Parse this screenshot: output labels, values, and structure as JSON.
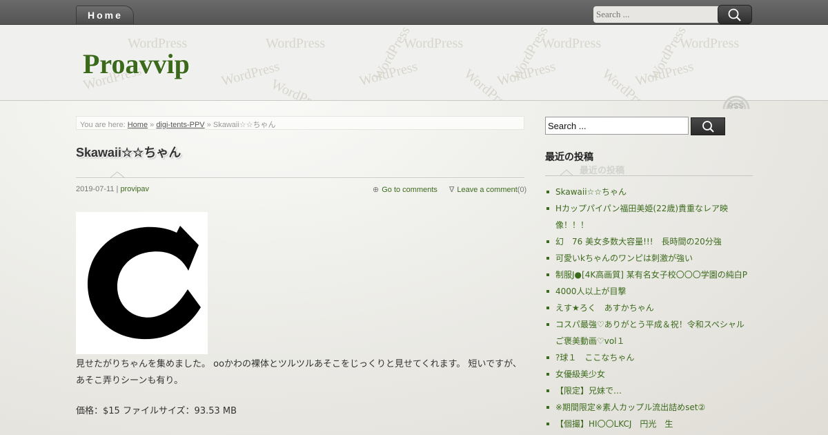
{
  "nav": {
    "home_label": "Home"
  },
  "top_search": {
    "placeholder": "Search ..."
  },
  "header": {
    "site_title": "Proavvip",
    "watermark": "WordPress",
    "rss_label": "RSS"
  },
  "breadcrumb": {
    "prefix": "You are here:",
    "home": "Home",
    "sep1": "»",
    "category": "digi-tents-PPV",
    "sep2": "»",
    "current": "Skawaii☆☆ちゃん"
  },
  "post": {
    "title": "Skawaii☆☆ちゃん",
    "date": "2019-07-11",
    "meta_sep": "|",
    "author": "provipav",
    "goto_symbol": "⊕",
    "goto_comments": "Go to comments",
    "leave_symbol": "∇",
    "leave_comment": "Leave a comment",
    "comment_count": "(0)",
    "body": "見せたがりちゃんを集めました。 ooかわの裸体とツルツルあそこをじっくりと見せてくれます。 短いですが、あそこ弄りシーンも有り。",
    "price": "価格：$15 ファイルサイズ：93.53 MB"
  },
  "sidebar": {
    "search_value": "Search ...",
    "widget_title": "最近の投稿",
    "recent_posts": [
      "Skawaii☆☆ちゃん",
      "Hカップパイパン福田美姫(22歳)貴重なレア映像！！！",
      "幻　76 美女多数大容量!!!　長時間の20分強",
      "可愛いkちゃんのワンピは刺激が強い",
      "制服J●[4K高画質] 某有名女子校〇〇〇学園の純白P",
      "4000人以上が目撃",
      "えす★ろく　あすかちゃん",
      "コスパ最強♡ありがとう平成＆祝！令和スペシャルご褒美動画♡vol１",
      "?球１　ここなちゃん",
      "女優級美少女",
      "【限定】兄妹で…",
      "※期間限定※素人カップル流出詰めset②",
      "【個撮】HI〇〇LKCJ　円光　生"
    ]
  },
  "icons": {
    "search": "magnifier-icon",
    "rss": "rss-icon",
    "thumbnail": "letter-c-logo"
  },
  "colors": {
    "accent_green": "#3c6a1c",
    "topbar": "#5e5e5e"
  }
}
